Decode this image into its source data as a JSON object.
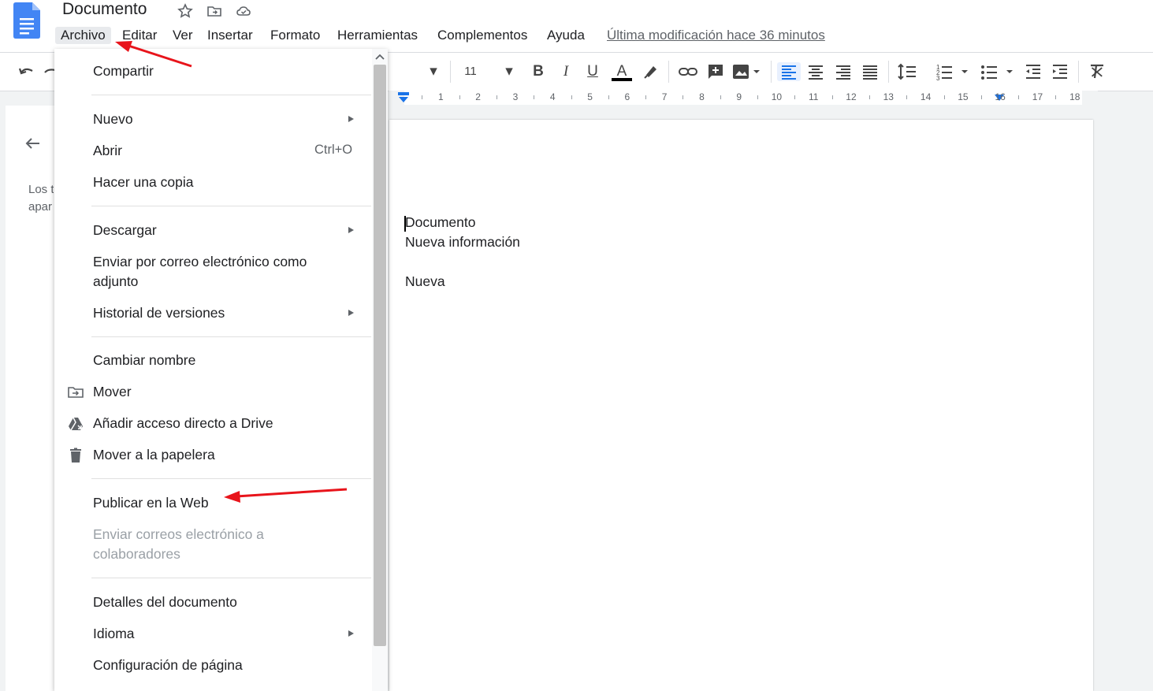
{
  "header": {
    "doc_title": "Documento",
    "menu": [
      "Archivo",
      "Editar",
      "Ver",
      "Insertar",
      "Formato",
      "Herramientas",
      "Complementos",
      "Ayuda"
    ],
    "last_edit": "Última modificación hace 36 minutos"
  },
  "toolbar": {
    "font_size": "11"
  },
  "ruler": {
    "numbers": [
      "1",
      "2",
      "3",
      "4",
      "5",
      "6",
      "7",
      "8",
      "9",
      "10",
      "11",
      "12",
      "13",
      "14",
      "15",
      "16",
      "17",
      "18"
    ]
  },
  "outline": {
    "text_lines": [
      "Los t",
      "apar"
    ]
  },
  "document": {
    "lines": [
      "Documento",
      "Nueva información",
      "Nueva"
    ]
  },
  "file_menu": {
    "share": "Compartir",
    "new": "Nuevo",
    "open": "Abrir",
    "open_shortcut": "Ctrl+O",
    "make_copy": "Hacer una copia",
    "download": "Descargar",
    "email_attachment_line1": "Enviar por correo electrónico como",
    "email_attachment_line2": "adjunto",
    "version_history": "Historial de versiones",
    "rename": "Cambiar nombre",
    "move": "Mover",
    "add_shortcut": "Añadir acceso directo a Drive",
    "trash": "Mover a la papelera",
    "publish": "Publicar en la Web",
    "email_collab_line1": "Enviar correos electrónico a",
    "email_collab_line2": "colaboradores",
    "details": "Detalles del documento",
    "language": "Idioma",
    "page_setup": "Configuración de página"
  },
  "colors": {
    "docs_blue": "#4285f4",
    "annotation_red": "#e8141b",
    "active_align": "#1a73e8"
  }
}
